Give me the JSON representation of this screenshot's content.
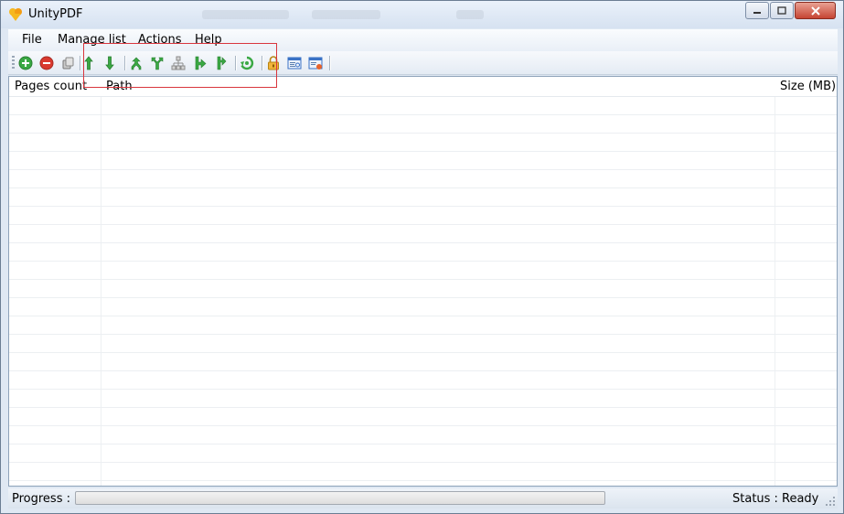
{
  "window": {
    "title": "UnityPDF"
  },
  "menubar": {
    "items": [
      {
        "label": "File"
      },
      {
        "label": "Manage list"
      },
      {
        "label": "Actions"
      },
      {
        "label": "Help"
      }
    ]
  },
  "toolbar": {
    "buttons": [
      {
        "icon": "add-icon",
        "color": "#3aa843"
      },
      {
        "icon": "remove-icon",
        "color": "#d9392f"
      },
      {
        "icon": "clear-icon",
        "color": "#8a8a8a"
      },
      {
        "icon": "move-up-icon",
        "color": "#3aa843"
      },
      {
        "icon": "move-down-icon",
        "color": "#3aa843"
      },
      {
        "icon": "merge-icon",
        "color": "#3aa843"
      },
      {
        "icon": "split-icon",
        "color": "#3aa843"
      },
      {
        "icon": "extract-icon",
        "color": "#9a9a9a"
      },
      {
        "icon": "insert-icon",
        "color": "#3aa843"
      },
      {
        "icon": "delete-pages-icon",
        "color": "#3aa843"
      },
      {
        "icon": "rotate-icon",
        "color": "#3aa843"
      },
      {
        "icon": "lock-icon",
        "color": "#e0a020"
      },
      {
        "icon": "properties-icon",
        "color": "#3a72c6"
      },
      {
        "icon": "info-icon",
        "color": "#3a72c6"
      }
    ]
  },
  "grid": {
    "columns": [
      {
        "label": "Pages count"
      },
      {
        "label": "Path"
      },
      {
        "label": "Size (MB)"
      }
    ],
    "rows": []
  },
  "statusbar": {
    "progress_label": "Progress :",
    "progress_value": 0,
    "status_label": "Status :",
    "status_value": "Ready"
  }
}
